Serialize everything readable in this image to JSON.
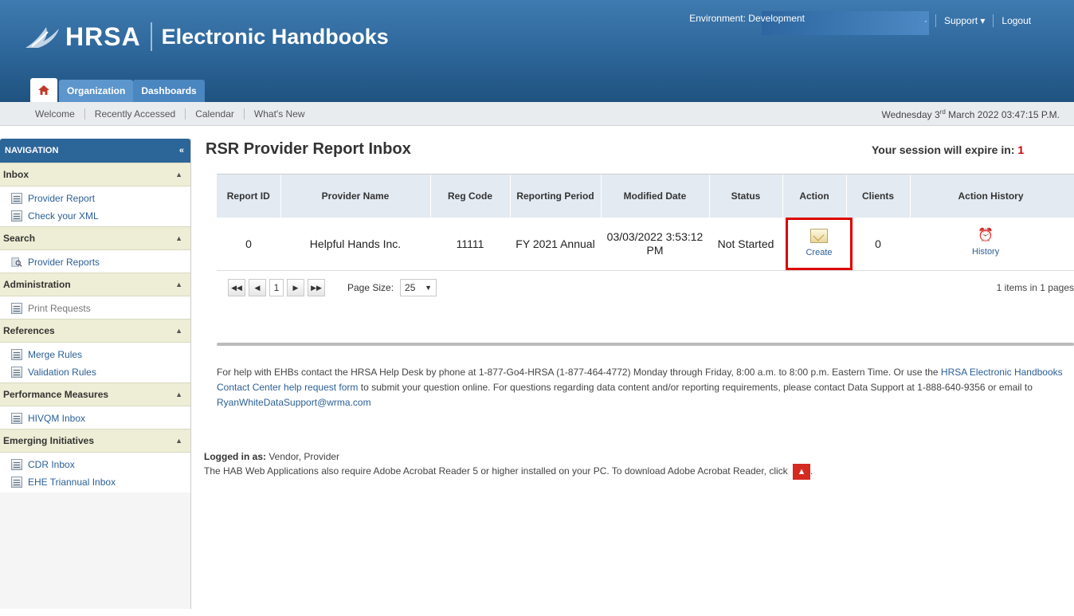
{
  "header": {
    "logo_text": "HRSA",
    "app_title": "Electronic Handbooks",
    "environment": "Environment: Development",
    "support_label": "Support",
    "logout_label": "Logout"
  },
  "tabs": [
    {
      "label": "Organization"
    },
    {
      "label": "Dashboards"
    }
  ],
  "subnav": {
    "items": [
      "Welcome",
      "Recently Accessed",
      "Calendar",
      "What's New"
    ],
    "date_prefix": "Wednesday 3",
    "date_sup": "rd",
    "date_suffix": " March 2022  03:47:15 P.M."
  },
  "sidebar": {
    "title": "NAVIGATION",
    "sections": [
      {
        "title": "Inbox",
        "links": [
          "Provider Report",
          "Check your XML"
        ]
      },
      {
        "title": "Search",
        "links": [
          "Provider Reports"
        ]
      },
      {
        "title": "Administration",
        "links": [
          "Print Requests"
        ]
      },
      {
        "title": "References",
        "links": [
          "Merge Rules",
          "Validation Rules"
        ]
      },
      {
        "title": "Performance Measures",
        "links": [
          "HIVQM Inbox"
        ]
      },
      {
        "title": "Emerging Initiatives",
        "links": [
          "CDR Inbox",
          "EHE Triannual Inbox"
        ]
      }
    ]
  },
  "main": {
    "title": "RSR Provider Report Inbox",
    "session_text": "Your session will expire in:",
    "session_num": "1"
  },
  "grid": {
    "columns": [
      "Report ID",
      "Provider Name",
      "Reg Code",
      "Reporting Period",
      "Modified Date",
      "Status",
      "Action",
      "Clients",
      "Action History"
    ],
    "rows": [
      {
        "report_id": "0",
        "provider_name": "Helpful Hands Inc.",
        "reg_code": "11111",
        "reporting_period": "FY 2021 Annual",
        "modified_date": "03/03/2022 3:53:12 PM",
        "status": "Not Started",
        "action": "Create",
        "clients": "0",
        "history": "History"
      }
    ],
    "pager": {
      "current_page": "1",
      "page_size_label": "Page Size:",
      "page_size": "25",
      "items_text": "1 items in 1 pages"
    }
  },
  "help": {
    "p1": "For help with EHBs contact the HRSA Help Desk by phone at 1-877-Go4-HRSA (1-877-464-4772) Monday through Friday, 8:00 a.m. to 8:00 p.m. Eastern Time. Or use the ",
    "link1": "HRSA Electronic Handbooks Contact Center help request form",
    "p2": " to submit your question online. For questions regarding data content and/or reporting requirements, please contact Data Support at 1-888-640-9356 or email to ",
    "link2": "RyanWhiteDataSupport@wrma.com"
  },
  "footer": {
    "logged_label": "Logged in as:",
    "logged_value": " Vendor, Provider",
    "acrobat_text": "The HAB Web Applications also require Adobe Acrobat Reader 5 or higher installed on your PC. To download Adobe Acrobat Reader, click",
    "pdf_label": "PDF"
  }
}
